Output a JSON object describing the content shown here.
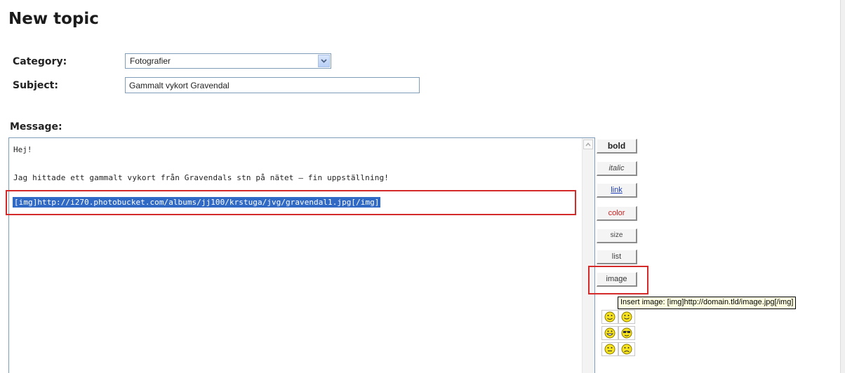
{
  "page": {
    "title": "New topic"
  },
  "form": {
    "category_label": "Category:",
    "category_value": "Fotografier",
    "subject_label": "Subject:",
    "subject_value": "Gammalt vykort Gravendal",
    "message_label": "Message:"
  },
  "message": {
    "line1": "Hej!",
    "line2": "Jag hittade ett gammalt vykort från Gravendals stn på nätet – fin uppställning!",
    "selected_text": "[img]http://i270.photobucket.com/albums/jj100/krstuga/jvg/gravendal1.jpg[/img]"
  },
  "toolbar": {
    "bold": "bold",
    "italic": "italic",
    "link": "link",
    "color": "color",
    "size": "size",
    "list": "list",
    "image": "image",
    "image_tooltip": "Insert image: [img]http://domain.tld/image.jpg[/img]"
  },
  "smileys": [
    "smile-icon",
    "smile-icon",
    "grin-icon",
    "cool-icon",
    "smile-icon",
    "sad-icon"
  ],
  "colors": {
    "highlight_border": "#d42a2a",
    "selection_bg": "#316ac5",
    "link_color": "#1f3fb7",
    "color_button_text": "#cc2020"
  }
}
